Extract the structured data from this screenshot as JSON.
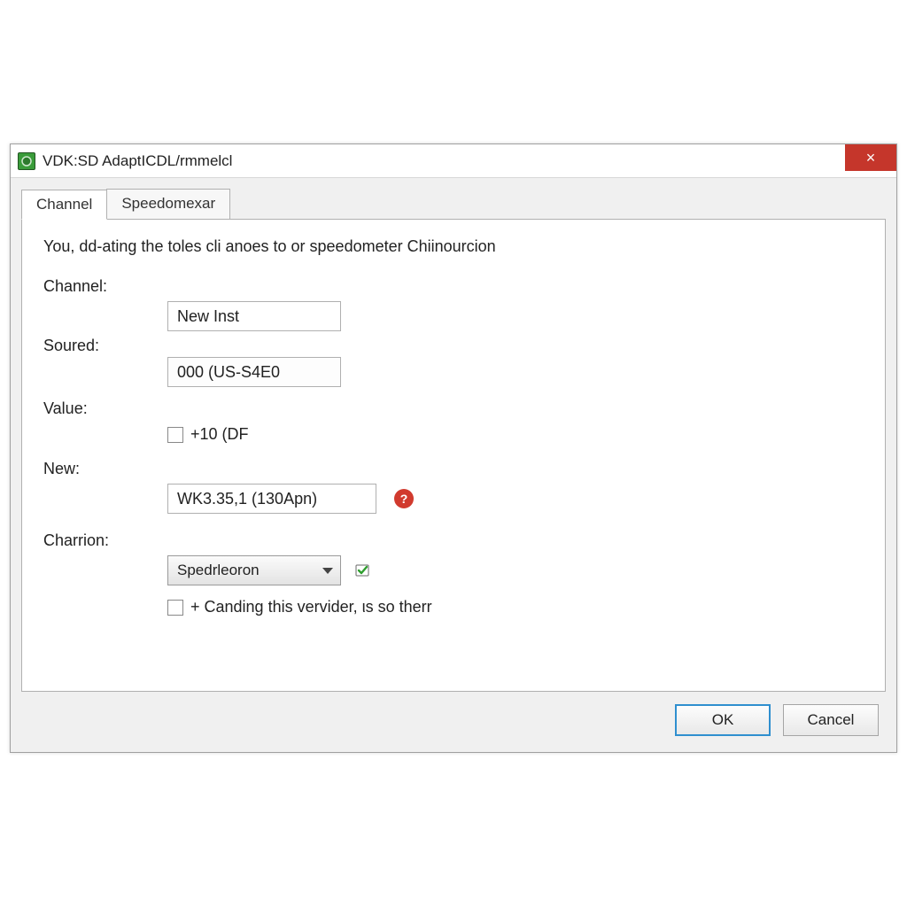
{
  "window": {
    "title": "VDK:SD AdaptICDL/rmmelcl"
  },
  "tabs": [
    {
      "label": "Channel",
      "active": true
    },
    {
      "label": "Speedomexar",
      "active": false
    }
  ],
  "intro": "You, dd-ating the toles cli anoes to or speedometer Chiinourcion",
  "fields": {
    "channel": {
      "label": "Channel:",
      "value": "New Inst"
    },
    "soured": {
      "label": "Soured:",
      "value": "000 (US-S4E0"
    },
    "value": {
      "label": "Value:"
    },
    "value_checkbox": {
      "text": "+10 (DF",
      "checked": false
    },
    "new": {
      "label": "New:",
      "value": "WK3.35,1 (130Apn)"
    },
    "charrion": {
      "label": "Charrion:",
      "selected": "Spedrleoron"
    },
    "canding_checkbox": {
      "text": "+ Canding this vervider, ιs so therr",
      "checked": false
    }
  },
  "icons": {
    "help": "?",
    "close": "×"
  },
  "buttons": {
    "ok": "OK",
    "cancel": "Cancel"
  }
}
